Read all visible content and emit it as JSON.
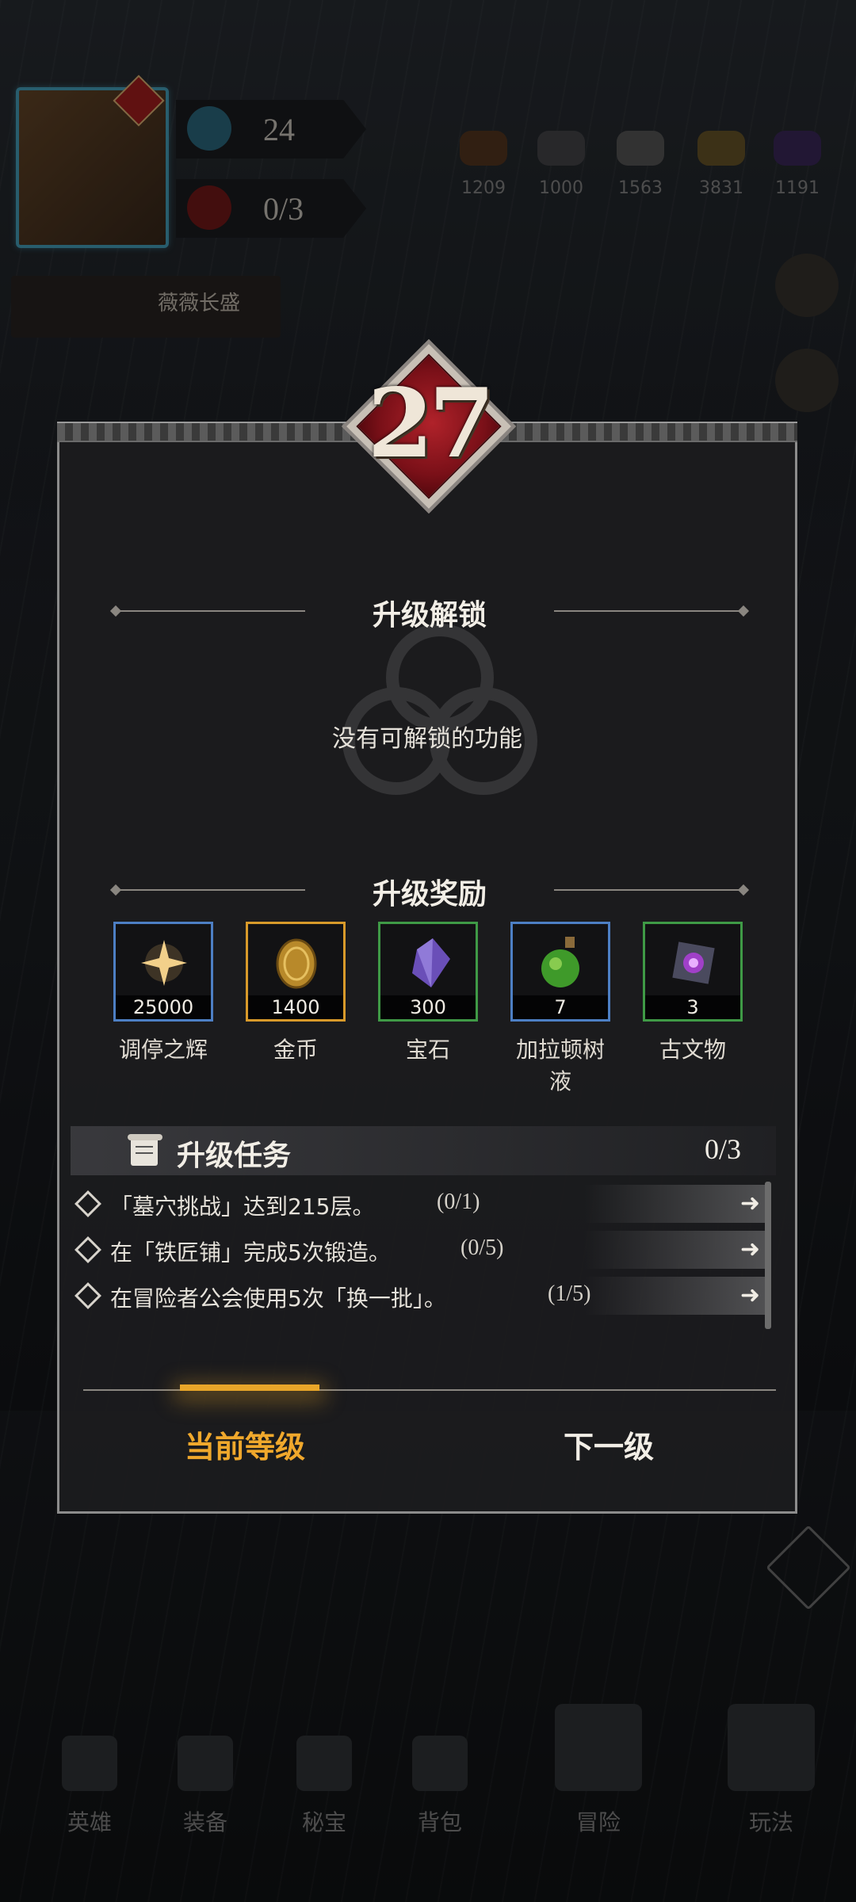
{
  "hud": {
    "stat_level": "24",
    "stat_progress": "0/3",
    "guild_label": "薇薇长盛"
  },
  "resources": [
    {
      "icon": "leather-icon",
      "count": "1209"
    },
    {
      "icon": "iron-ore-icon",
      "count": "1000"
    },
    {
      "icon": "stone-icon",
      "count": "1563"
    },
    {
      "icon": "gold-ore-icon",
      "count": "3831"
    },
    {
      "icon": "crystal-icon",
      "count": "1191"
    }
  ],
  "modal": {
    "level": "27",
    "unlock_title": "升级解锁",
    "unlock_message": "没有可解锁的功能",
    "rewards_title": "升级奖励",
    "rewards": [
      {
        "name": "调停之辉",
        "qty": "25000",
        "border": "#4d7fc4",
        "icon": "radiant-star-icon"
      },
      {
        "name": "金币",
        "qty": "1400",
        "border": "#d89a2a",
        "icon": "gold-coin-icon"
      },
      {
        "name": "宝石",
        "qty": "300",
        "border": "#3f9a46",
        "icon": "gem-icon"
      },
      {
        "name": "加拉顿树液",
        "qty": "7",
        "border": "#4d7fc4",
        "icon": "potion-icon"
      },
      {
        "name": "古文物",
        "qty": "3",
        "border": "#3f9a46",
        "icon": "artifact-icon"
      }
    ],
    "tasks_title": "升级任务",
    "tasks_count": "0/3",
    "tasks": [
      {
        "text": "「墓穴挑战」达到215层。",
        "progress": "(0/1)"
      },
      {
        "text": "在「铁匠铺」完成5次锻造。",
        "progress": "(0/5)"
      },
      {
        "text": "在冒险者公会使用5次「换一批」。",
        "progress": "(1/5)"
      }
    ],
    "tab_current": "当前等级",
    "tab_next": "下一级"
  },
  "bottom_nav": [
    {
      "label": "英雄",
      "icon": "hero-icon"
    },
    {
      "label": "装备",
      "icon": "equipment-icon"
    },
    {
      "label": "秘宝",
      "icon": "treasure-icon"
    },
    {
      "label": "背包",
      "icon": "bag-icon"
    },
    {
      "label": "冒险",
      "icon": "adventure-icon"
    },
    {
      "label": "玩法",
      "icon": "gameplay-icon"
    }
  ]
}
